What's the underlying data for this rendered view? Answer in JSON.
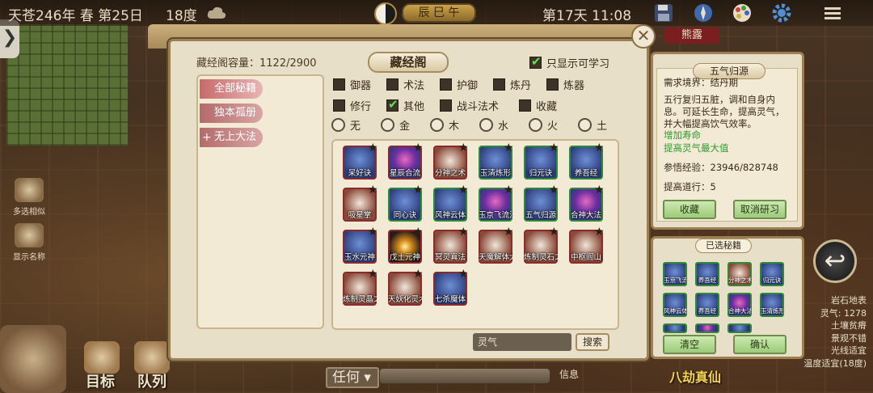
{
  "hud": {
    "date": "天苍246年 春 第25日",
    "temperature": "18度",
    "season_badge": "辰 巳 午",
    "day_time": "第17天 11:08",
    "save_label": "保存",
    "xionglu": "熊露"
  },
  "left_tools": [
    {
      "label": "多选相似"
    },
    {
      "label": "显示名称"
    }
  ],
  "bottom_bar": {
    "target": "目标",
    "queue": "队列",
    "task": "任何",
    "info": "信息",
    "bajie": "八劫真仙"
  },
  "terrain": {
    "lines": [
      "岩石地表",
      "灵气: 1278",
      "土壤贫瘠",
      "景观不错",
      "光线适宜",
      "温度适宜(18度)"
    ]
  },
  "library": {
    "capacity_label": "藏经阁容量：1122/2900",
    "title": "藏经阁",
    "learnable_only": "只显示可学习",
    "categories": [
      {
        "label": "全部秘籍",
        "active": true
      },
      {
        "label": "独本孤册",
        "active": false
      },
      {
        "label": "无上大法",
        "active": false
      }
    ],
    "type_filters": [
      {
        "label": "御器",
        "checked": false
      },
      {
        "label": "术法",
        "checked": false
      },
      {
        "label": "护御",
        "checked": false
      },
      {
        "label": "炼丹",
        "checked": false
      },
      {
        "label": "炼器",
        "checked": false
      },
      {
        "label": "修行",
        "checked": false
      },
      {
        "label": "其他",
        "checked": true
      },
      {
        "label": "战斗法术",
        "checked": false
      },
      {
        "label": "收藏",
        "checked": false
      }
    ],
    "element_filters": [
      "无",
      "金",
      "木",
      "水",
      "火",
      "土"
    ],
    "items": [
      {
        "label": "呆好诀",
        "style": "blue",
        "border": "red"
      },
      {
        "label": "星辰合流",
        "style": "spiral",
        "border": "red"
      },
      {
        "label": "分神之术",
        "style": "palm",
        "border": "red"
      },
      {
        "label": "玉清炼形",
        "style": "blue",
        "border": "green"
      },
      {
        "label": "归元诀",
        "style": "blue",
        "border": "green"
      },
      {
        "label": "养吾经",
        "style": "blue",
        "border": "green"
      },
      {
        "label": "吸星掌",
        "style": "palm",
        "border": "red"
      },
      {
        "label": "同心诀",
        "style": "blue",
        "border": "green"
      },
      {
        "label": "风神云体",
        "style": "blue",
        "border": "green"
      },
      {
        "label": "玉京飞流法",
        "style": "spiral",
        "border": "green"
      },
      {
        "label": "五气归源",
        "style": "blue",
        "border": "green"
      },
      {
        "label": "合神大法",
        "style": "spiral",
        "border": "green"
      },
      {
        "label": "玉水元神",
        "style": "blue",
        "border": "red"
      },
      {
        "label": "戊土元神",
        "style": "orbs",
        "border": "red"
      },
      {
        "label": "冥灵真法",
        "style": "palm",
        "border": "red"
      },
      {
        "label": "天魔解体大法",
        "style": "palm",
        "border": "red"
      },
      {
        "label": "炼制灵石之术",
        "style": "palm",
        "border": "red"
      },
      {
        "label": "中枢阎山",
        "style": "palm",
        "border": "red"
      },
      {
        "label": "炼制灵晶之术",
        "style": "palm",
        "border": "red"
      },
      {
        "label": "天妖化灵术",
        "style": "palm",
        "border": "red"
      },
      {
        "label": "七杀魔体",
        "style": "blue",
        "border": "red"
      }
    ],
    "search_placeholder": "灵气",
    "search_button": "搜索"
  },
  "detail": {
    "title": "五气归源",
    "requirement": "需求境界：结丹期",
    "description": "五行复归五脏，调和自身内息。可延长生命，提高灵气，并大幅提高饮气效率。",
    "effect1": "增加寿命",
    "effect2": "提高灵气最大值",
    "exp": "参悟经验：23946/828748",
    "dao": "提高道行：5",
    "collect_button": "收藏",
    "cancel_button": "取消研习"
  },
  "selected": {
    "title": "已选秘籍",
    "items": [
      "玉京飞流法",
      "养吾经",
      "分神之术",
      "归元诀",
      "风神云体",
      "养吾经",
      "合神大法",
      "玉清炼形",
      "",
      "",
      "",
      ""
    ],
    "clear_button": "清空",
    "confirm_button": "确认"
  }
}
